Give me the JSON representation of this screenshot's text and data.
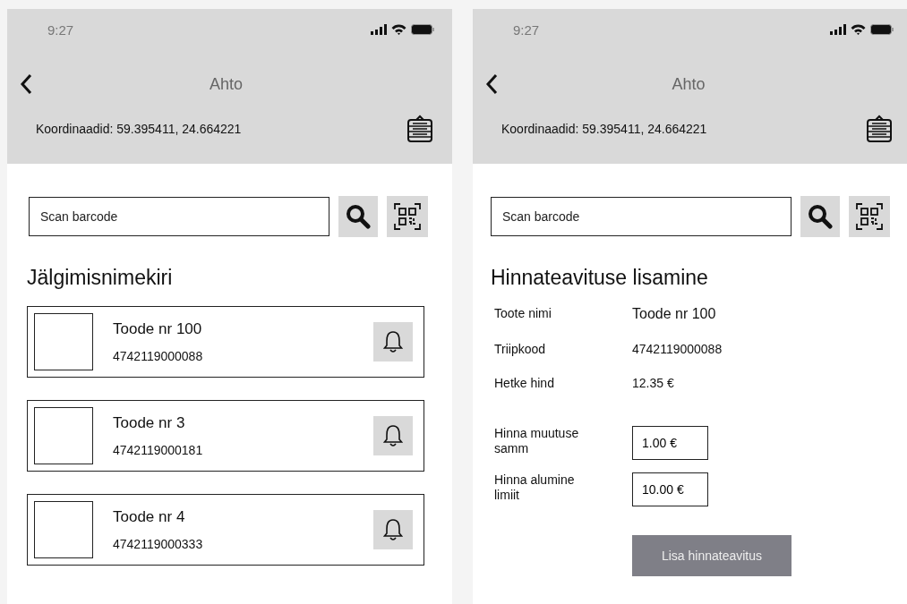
{
  "screens": [
    {
      "status_bar": {
        "time": "9:27"
      },
      "header": {
        "title": "Ahto",
        "coordinates": "Koordinaadid: 59.395411, 24.664221"
      },
      "search": {
        "placeholder": "Scan barcode"
      },
      "content": {
        "kind": "watchlist",
        "heading": "Jälgimisnimekiri",
        "items": [
          {
            "name": "Toode nr 100",
            "barcode": "4742119000088"
          },
          {
            "name": "Toode nr 3",
            "barcode": "4742119000181"
          },
          {
            "name": "Toode nr 4",
            "barcode": "4742119000333"
          }
        ]
      }
    },
    {
      "status_bar": {
        "time": "9:27"
      },
      "header": {
        "title": "Ahto",
        "coordinates": "Koordinaadid: 59.395411, 24.664221"
      },
      "search": {
        "placeholder": "Scan barcode"
      },
      "content": {
        "kind": "price_alert_form",
        "heading": "Hinnateavituse lisamine",
        "details": [
          {
            "label": "Toote nimi",
            "value": "Toode nr 100",
            "emphasis": true
          },
          {
            "label": "Triipkood",
            "value": "4742119000088",
            "emphasis": false
          },
          {
            "label": "Hetke hind",
            "value": "12.35 €",
            "emphasis": false
          }
        ],
        "fields": [
          {
            "label": "Hinna muutuse samm",
            "value": "1.00 €"
          },
          {
            "label": "Hinna alumine limiit",
            "value": "10.00 €"
          }
        ],
        "button": "Lisa hinnateavitus"
      }
    }
  ]
}
